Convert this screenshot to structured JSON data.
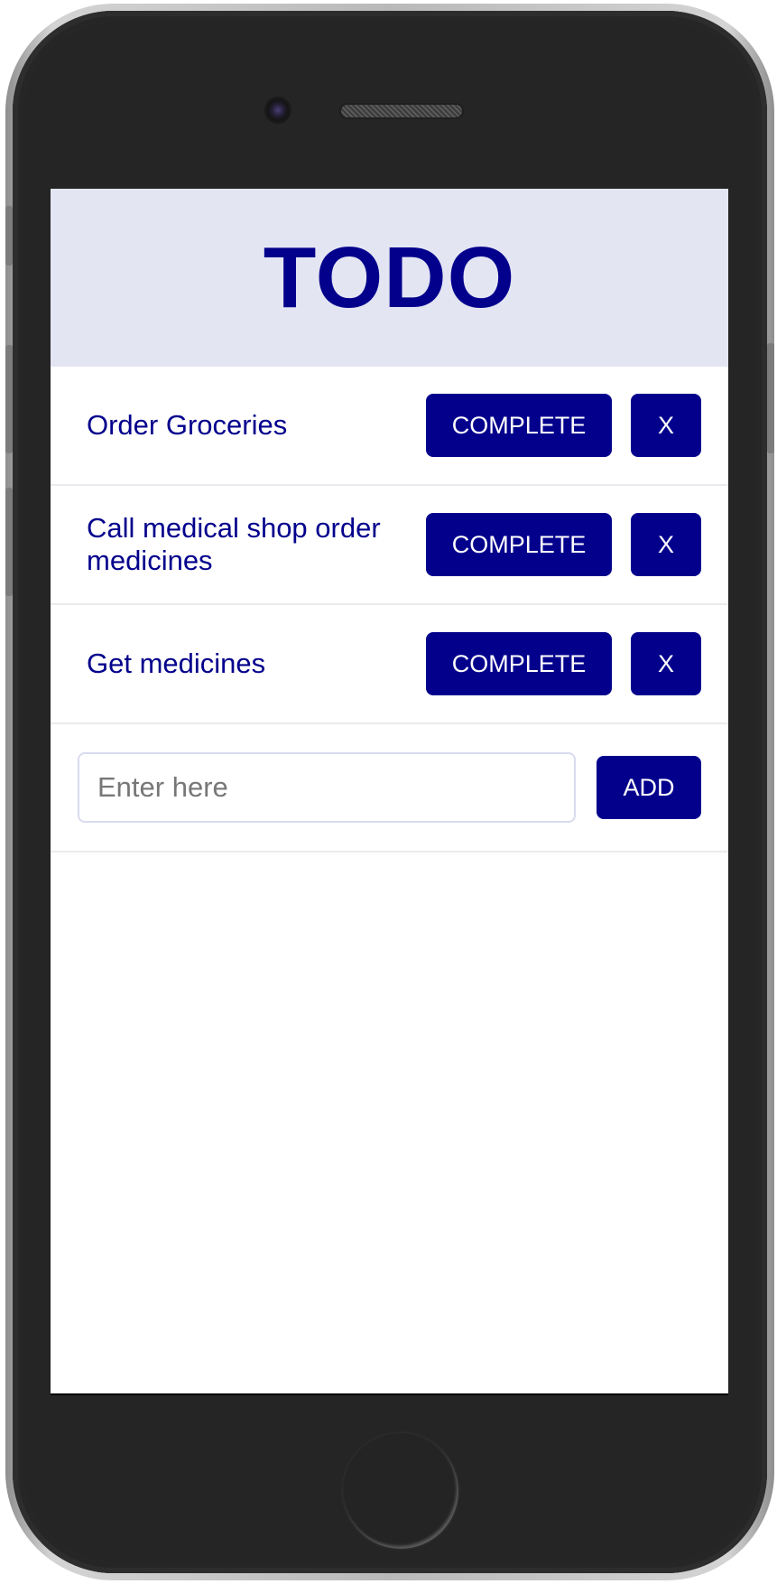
{
  "app": {
    "title": "TODO"
  },
  "todos": [
    {
      "text": "Order Groceries",
      "complete_label": "COMPLETE",
      "delete_label": "X"
    },
    {
      "text": "Call medical shop order medicines",
      "complete_label": "COMPLETE",
      "delete_label": "X"
    },
    {
      "text": "Get medicines",
      "complete_label": "COMPLETE",
      "delete_label": "X"
    }
  ],
  "add_form": {
    "placeholder": "Enter here",
    "value": "",
    "add_label": "ADD"
  },
  "colors": {
    "accent": "#03008c",
    "header_bg": "#e4e5f3",
    "button_text": "#ffffff"
  }
}
